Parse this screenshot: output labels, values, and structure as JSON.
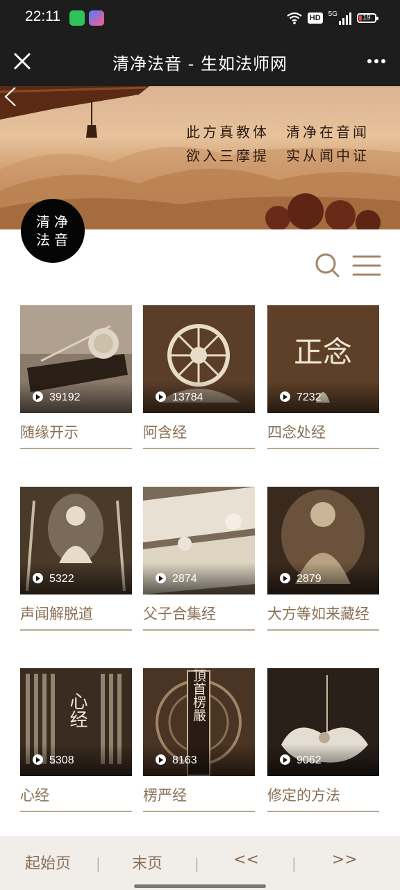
{
  "status_bar": {
    "time": "22:11",
    "icons": [
      "wifi-icon",
      "hd-badge",
      "signal-5g-icon",
      "battery-icon"
    ],
    "hd_label": "HD",
    "network_label": "5G",
    "battery_level": "19"
  },
  "nav": {
    "title": "清净法音 - 生如法师网",
    "close_icon": "close-icon",
    "more_icon": "more-icon"
  },
  "banner": {
    "line1": "此方真教体　清净在音闻",
    "line2": "欲入三摩提　实从闻中证"
  },
  "logo": {
    "line1": "清净",
    "line2": "法音"
  },
  "toolbar": {
    "search_icon": "search-icon",
    "menu_icon": "menu-icon"
  },
  "items": [
    {
      "title": "随缘开示",
      "count": "39192"
    },
    {
      "title": "阿含经",
      "count": "13784"
    },
    {
      "title": "四念处经",
      "count": "7232"
    },
    {
      "title": "声闻解脱道",
      "count": "5322"
    },
    {
      "title": "父子合集经",
      "count": "2874"
    },
    {
      "title": "大方等如来藏经",
      "count": "2879"
    },
    {
      "title": "心经",
      "count": "5308"
    },
    {
      "title": "楞严经",
      "count": "8163"
    },
    {
      "title": "修定的方法",
      "count": "9062"
    }
  ],
  "thumb_text": {
    "item3": "正念",
    "item7": "心经",
    "item8": "大佛頂首楞嚴"
  },
  "pager": {
    "first": "起始页",
    "last": "末页",
    "prev": "<<",
    "next": ">>",
    "separator": "|"
  },
  "colors": {
    "accent": "#8a6f56",
    "divider": "#b7a693",
    "header_bg": "#1d1d1d",
    "pager_bg": "#f1ede8"
  }
}
